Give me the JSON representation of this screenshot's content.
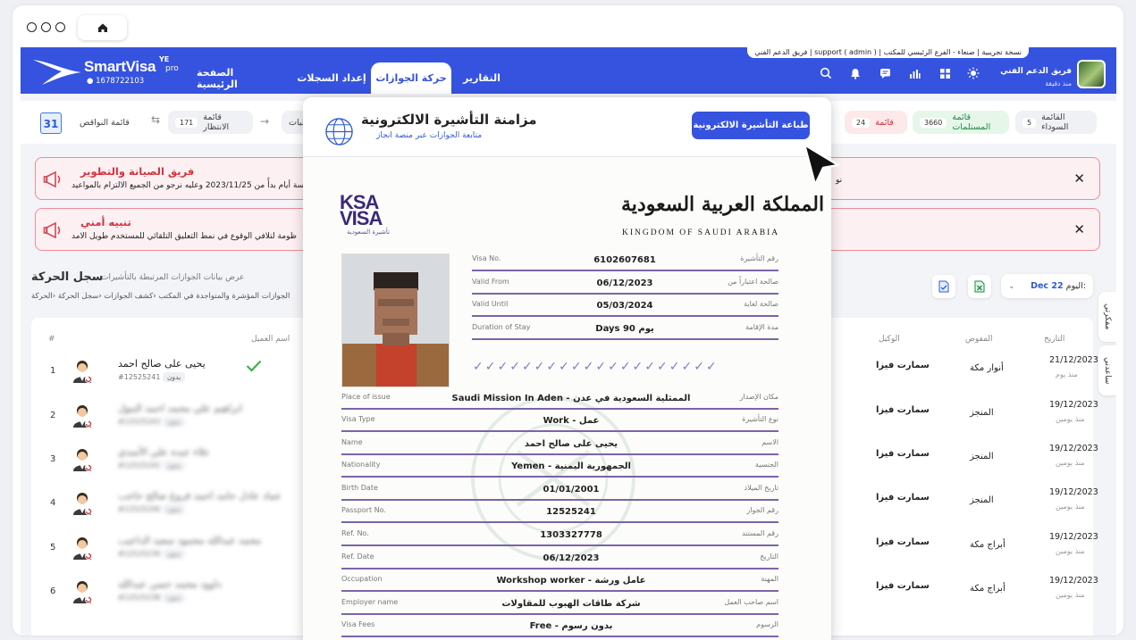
{
  "browser": {
    "home_icon": "home-icon"
  },
  "app": {
    "brand": "SmartVisa",
    "brand_sup": "YE",
    "brand_pro": "pro",
    "phone": "1678722103",
    "header_line": "فريق الدعم الفني | support ( admin ) | نسخة تجريبية | صنعاء - الفرع الرئيسي للمكتب",
    "user_name": "فريق الدعم الفني",
    "user_sub": "منذ دقيقة",
    "colors": {
      "primary": "#3553df",
      "danger": "#d2343f",
      "success": "#1d8a3d"
    }
  },
  "nav": {
    "tabs": [
      {
        "label": "التقارير"
      },
      {
        "label": "حركة الجوازات"
      },
      {
        "label": "إعداد السجلات"
      },
      {
        "label": "الصفحة الرئيسية"
      }
    ]
  },
  "statusbar": {
    "calendar_day": "31",
    "items": [
      {
        "label": "القائمة السوداء",
        "count": "5"
      },
      {
        "label": "قائمة المستلمات",
        "count": "3660"
      },
      {
        "label": "قائمة",
        "count": "24"
      },
      {
        "label": "رسائليات",
        "count": ""
      },
      {
        "label": "قائمة الانتظار",
        "count": "171"
      },
      {
        "label": "قائمة النواقص",
        "count": ""
      }
    ]
  },
  "alerts": [
    {
      "title": "فريق الصيانة والتطوير",
      "text": "خمسة أيام بدأً من 2023/11/25 وعليه نرجو من الجميع الالتزام بالمواعيد",
      "right_text": "نو"
    },
    {
      "title": "تنبيه أمني",
      "text": "ظومة لتلافي الوقوع في نمط التعليق التلقائي للمستخدم طويل الامد",
      "right_text": ""
    }
  ],
  "section": {
    "title": "سجل الحركة",
    "subtitle": "عرض بيانات الجوازات المرتبطة بالتأشيرات",
    "desc": "الجوازات المؤشرة والمتواجدة في المكتب ‹كشف الجوازات ‹سجل الحركة ‹الحركة",
    "date_label": "اليوم:",
    "date_value": "Dec 22"
  },
  "table": {
    "headers": {
      "num": "#",
      "client": "اسم العميل",
      "agent": "الوكيل",
      "authorized": "المفوض",
      "date": "التاريخ"
    },
    "rows": [
      {
        "num": "1",
        "name": "يحيى على صالح احمد",
        "id": "#12525241",
        "tag": "بدون",
        "agent": "سمارت فيزا",
        "authorized": "أنوار مكة",
        "date": "21/12/2023",
        "ago": "منذ يوم"
      },
      {
        "num": "2",
        "name": "ابراهيم علي محمد احمد البتول",
        "id": "#12525243",
        "tag": "بدون",
        "agent": "سمارت فيزا",
        "authorized": "المنجز",
        "date": "19/12/2023",
        "ago": "منذ يومين"
      },
      {
        "num": "3",
        "name": "علاء عبده علي الأسدي",
        "id": "#12525242",
        "tag": "بدون",
        "agent": "سمارت فيزا",
        "authorized": "المنجز",
        "date": "19/12/2023",
        "ago": "منذ يومين"
      },
      {
        "num": "4",
        "name": "عماد عادل حامد احمد فروغ صالح حاجب",
        "id": "#12525240",
        "tag": "بدون",
        "agent": "سمارت فيزا",
        "authorized": "المنجز",
        "date": "19/12/2023",
        "ago": "منذ يومين"
      },
      {
        "num": "5",
        "name": "محمد عبدالله محمود سعيد الداعيب",
        "id": "#12525239",
        "tag": "بدون",
        "agent": "سمارت فيزا",
        "authorized": "أبراج مكة",
        "date": "19/12/2023",
        "ago": "منذ يومين"
      },
      {
        "num": "6",
        "name": "داوود محمد حسن عبدالله",
        "id": "#12525238",
        "tag": "بدون",
        "agent": "سمارت فيزا",
        "authorized": "أبراج مكة",
        "date": "19/12/2023",
        "ago": "منذ يومين"
      }
    ]
  },
  "side_tabs": [
    "مفكرتي",
    "ساعدني"
  ],
  "modal": {
    "title": "مزامنة التأشيرة الالكترونية",
    "subtitle": "متابعة الجوازات عبر منصة انجاز",
    "print_button": "طباعة التأشيرة الالكترونية",
    "visa": {
      "logo_l1": "KSA",
      "logo_l2": "VISA",
      "logo_l3": "تأشيرة السعودية",
      "kingdom_ar": "المملكة العربية السعودية",
      "kingdom_en": "KINGDOM OF SAUDI ARABIA",
      "top_fields": [
        {
          "en": "Visa No.",
          "value": "6102607681",
          "ar": "رقم التأشيرة"
        },
        {
          "en": "Valid From",
          "value": "06/12/2023",
          "ar": "صالحة اعتباراً من"
        },
        {
          "en": "Valid Until",
          "value": "05/03/2024",
          "ar": "صالحة لغاية"
        },
        {
          "en": "Duration of Stay",
          "value": "Days 90 يوم",
          "ar": "مدة الإقامة"
        }
      ],
      "fields": [
        {
          "en": "Place of issue",
          "value": "Saudi Mission In Aden - الممثلية السعودية في عدن",
          "ar": "مكان الإصدار"
        },
        {
          "en": "Visa Type",
          "value": "Work - عمل",
          "ar": "نوع التأشيرة"
        },
        {
          "en": "Name",
          "value": "يحيى على صالح احمد",
          "ar": "الاسم"
        },
        {
          "en": "Nationality",
          "value": "Yemen - الجمهورية اليمنية",
          "ar": "الجنسية"
        },
        {
          "en": "Birth Date",
          "value": "01/01/2001",
          "ar": "تاريخ الميلاد"
        },
        {
          "en": "Passport No.",
          "value": "12525241",
          "ar": "رقم الجواز"
        },
        {
          "en": "Ref. No.",
          "value": "1303327778",
          "ar": "رقم المستند"
        },
        {
          "en": "Ref. Date",
          "value": "06/12/2023",
          "ar": "التاريخ"
        },
        {
          "en": "Occupation",
          "value": "Workshop worker - عامل ورشة",
          "ar": "المهنة"
        },
        {
          "en": "Employer name",
          "value": "شركة طاقات الهبوب للمقاولات",
          "ar": "اسم صاحب العمل"
        },
        {
          "en": "Visa Fees",
          "value": "Free - بدون رسوم",
          "ar": "الرسوم"
        }
      ]
    }
  }
}
